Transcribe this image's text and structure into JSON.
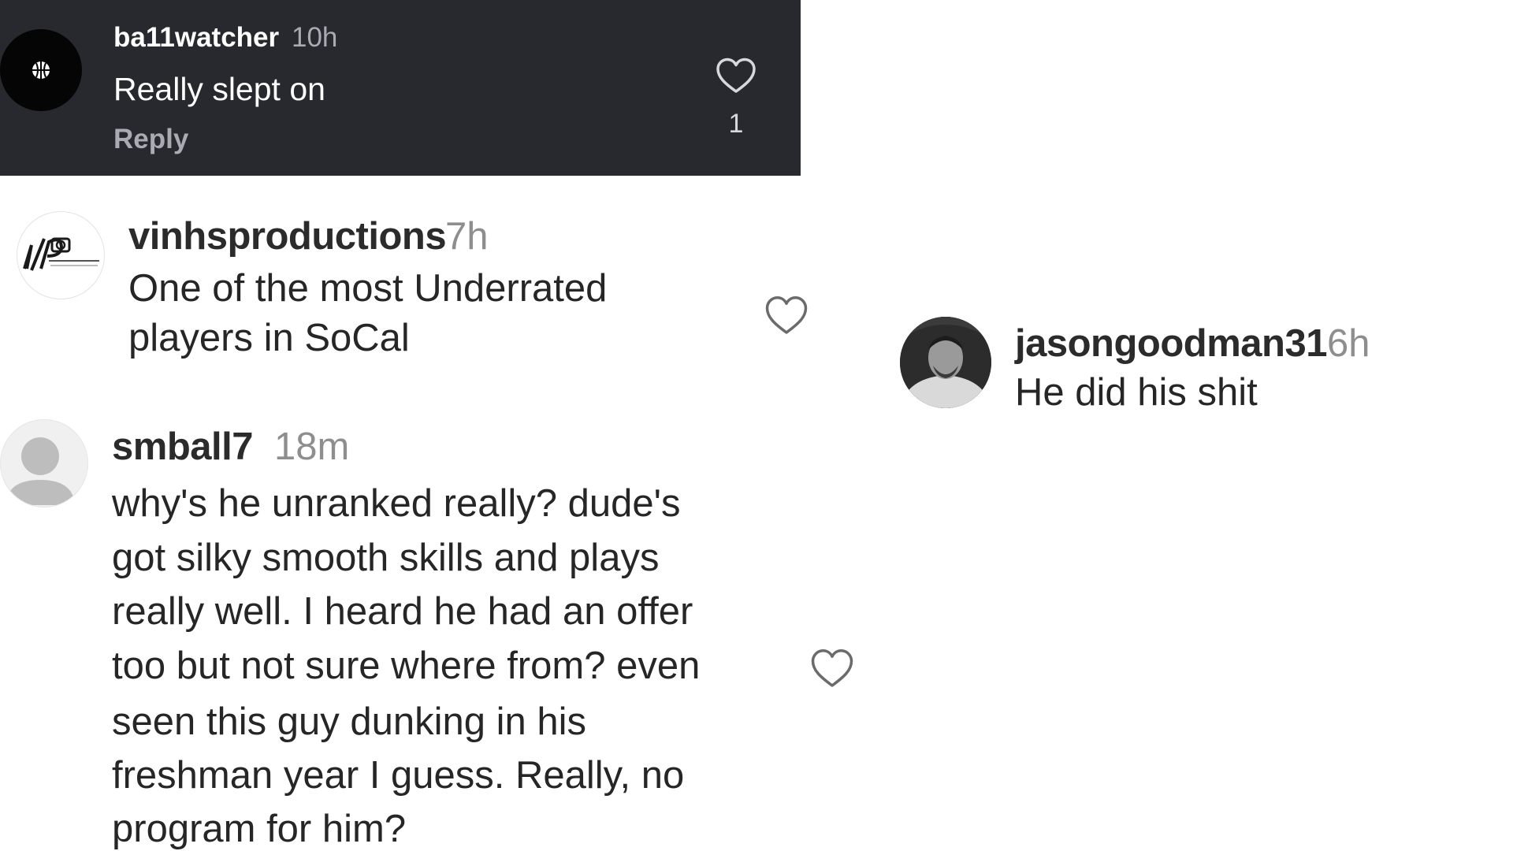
{
  "colors": {
    "dark_bg": "#27292f",
    "dark_text": "#ffffff",
    "dark_muted": "#a8abb2",
    "light_text": "#262626",
    "light_muted": "#8e8e8e"
  },
  "comments": [
    {
      "username": "ba11watcher",
      "time": "10h",
      "text": "Really slept on",
      "reply_label": "Reply",
      "like_count": "1",
      "like_icon": "heart-outline-icon",
      "avatar_icon": "basketball-logo-avatar",
      "highlighted": true
    },
    {
      "username": "vinhsproductions",
      "time": "7h",
      "text_lines": [
        "One of the most Underrated",
        "players in SoCal"
      ],
      "like_icon": "heart-outline-icon",
      "avatar_icon": "vp-productions-logo-avatar"
    },
    {
      "username": "smball7",
      "time": "18m",
      "text_lines": [
        "why's he unranked really? dude's",
        "got silky smooth skills and plays",
        "really well. I heard he had an offer",
        "too but not sure where from? even",
        "seen this guy dunking in his",
        "freshman year I guess. Really, no",
        "program for him?"
      ],
      "like_icon": "heart-outline-icon",
      "avatar_icon": "default-user-avatar"
    },
    {
      "username": "jasongoodman31",
      "time": "6h",
      "text": "He did his shit",
      "avatar_icon": "photo-avatar"
    }
  ]
}
